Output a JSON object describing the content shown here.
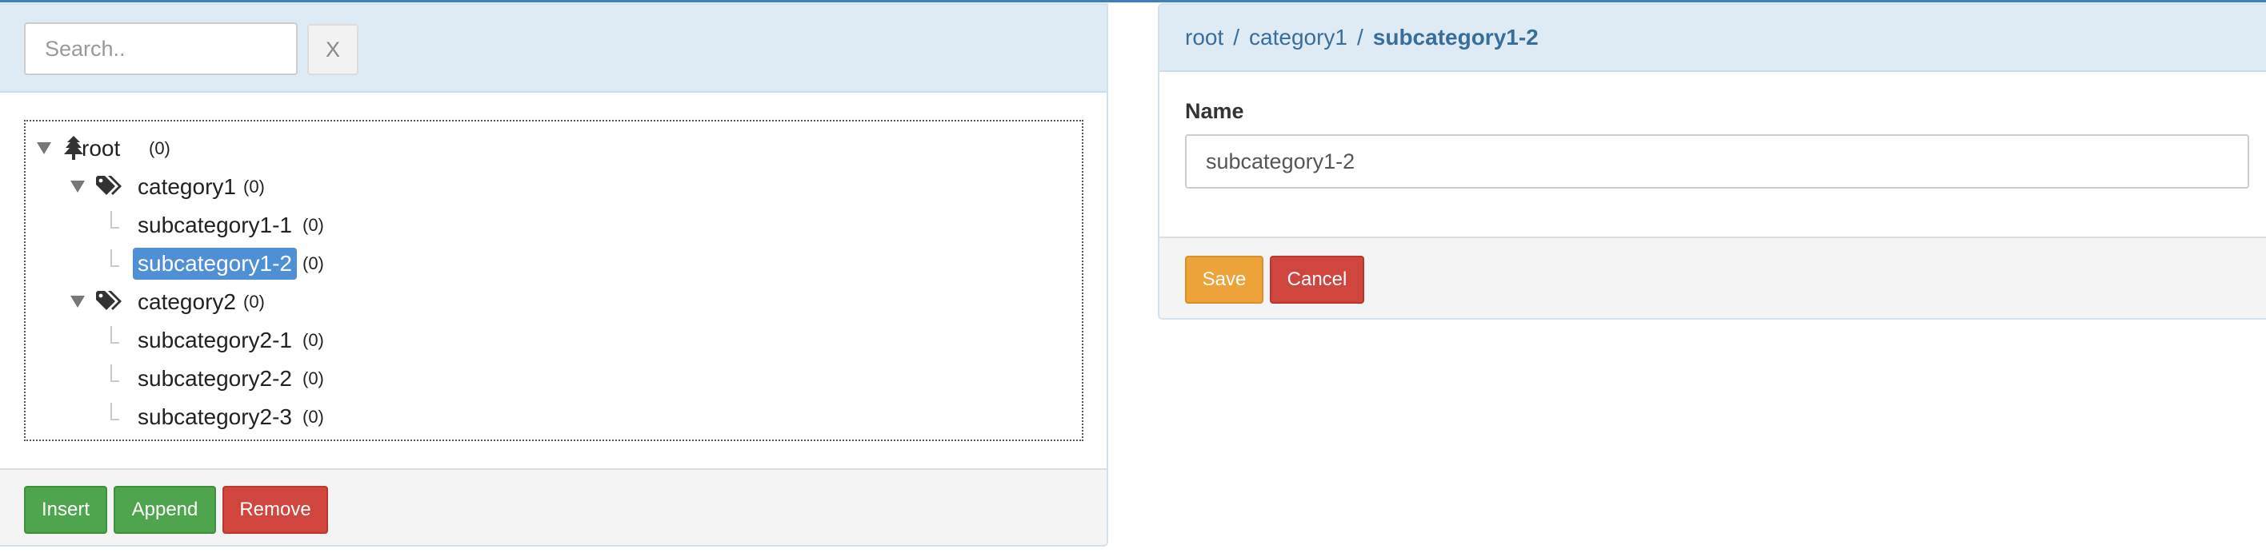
{
  "search": {
    "placeholder": "Search..",
    "value": "",
    "clear_label": "X"
  },
  "tree": {
    "nodes": [
      {
        "label": "root",
        "count": "(0)",
        "icon": "tree-icon",
        "expanded": true,
        "level": 0
      },
      {
        "label": "category1",
        "count": "(0)",
        "icon": "tags-icon",
        "expanded": true,
        "level": 1
      },
      {
        "label": "subcategory1-1",
        "count": "(0)",
        "level": 2
      },
      {
        "label": "subcategory1-2",
        "count": "(0)",
        "level": 2,
        "selected": true
      },
      {
        "label": "category2",
        "count": "(0)",
        "icon": "tags-icon",
        "expanded": true,
        "level": 1
      },
      {
        "label": "subcategory2-1",
        "count": "(0)",
        "level": 2
      },
      {
        "label": "subcategory2-2",
        "count": "(0)",
        "level": 2
      },
      {
        "label": "subcategory2-3",
        "count": "(0)",
        "level": 2
      }
    ]
  },
  "tree_actions": {
    "insert": "Insert",
    "append": "Append",
    "remove": "Remove"
  },
  "detail": {
    "breadcrumb": {
      "root": "root",
      "category": "category1",
      "current": "subcategory1-2",
      "separator": "/"
    },
    "name_label": "Name",
    "name_value": "subcategory1-2",
    "save": "Save",
    "cancel": "Cancel"
  },
  "colors": {
    "header_bg": "#dfebf4",
    "selected_bg": "#4f8fd6",
    "green": "#4ea54e",
    "red": "#d0463e",
    "orange": "#eda23a",
    "link": "#3a6e9a"
  }
}
